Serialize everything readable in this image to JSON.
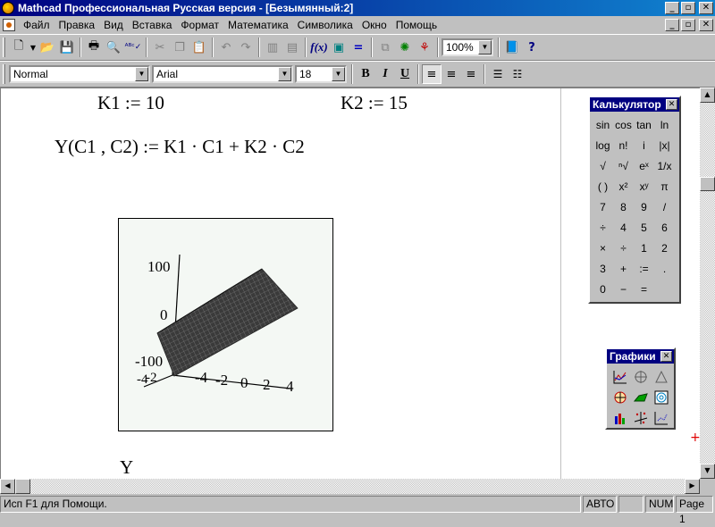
{
  "window": {
    "title": "Mathcad Профессиональная Русская версия - [Безымянный:2]",
    "buttons": [
      "_",
      "▫",
      "✕"
    ]
  },
  "menu": {
    "items": [
      "Файл",
      "Правка",
      "Вид",
      "Вставка",
      "Формат",
      "Математика",
      "Символика",
      "Окно",
      "Помощь"
    ],
    "doc_buttons": [
      "_",
      "▫",
      "✕"
    ]
  },
  "toolbar": {
    "zoom": "100%",
    "icons": [
      "new-icon",
      "open-icon",
      "save-icon",
      "print-icon",
      "print-preview-icon",
      "spellcheck-icon",
      "cut-icon",
      "copy-icon",
      "paste-icon",
      "undo-icon",
      "redo-icon",
      "align-icon",
      "insert-function-icon",
      "insert-unit-icon",
      "calculate-icon",
      "component-icon",
      "wizard-icon",
      "distributed-icon",
      "resource-center-icon",
      "help-icon"
    ]
  },
  "format_toolbar": {
    "style": "Normal",
    "font": "Arial",
    "size": "18",
    "bold": "B",
    "italic": "I",
    "underline": "U"
  },
  "worksheet": {
    "k1": "K1 := 10",
    "k2": "K2 := 15",
    "function_def": "Y(C1 , C2) := K1 · C1 + K2 · C2",
    "plot_label": "Y",
    "plot": {
      "z_ticks": [
        "100",
        "0",
        "-100"
      ],
      "x_ticks": [
        "-4",
        "-2",
        "0",
        "2",
        "4"
      ],
      "y_ticks": [
        "-4",
        "-2"
      ]
    }
  },
  "calculator": {
    "title": "Калькулятор",
    "buttons": [
      "sin",
      "cos",
      "tan",
      "ln",
      "log",
      "n!",
      "i",
      "|x|",
      "√",
      "ⁿ√",
      "eˣ",
      "1/x",
      "( )",
      "x²",
      "xʸ",
      "π",
      "7",
      "8",
      "9",
      "/",
      "÷",
      "4",
      "5",
      "6",
      "×",
      "÷",
      "1",
      "2",
      "3",
      "+",
      ":=",
      ".",
      "0",
      "−",
      "="
    ]
  },
  "graphs": {
    "title": "Графики",
    "icons": [
      "xy-plot-icon",
      "polar-plot-icon",
      "surface-plot-icon",
      "contour-plot-icon",
      "3d-scatter-icon",
      "3d-bar-icon",
      "vector-field-icon",
      "3d-scatter-alt-icon",
      "plot-wizard-icon"
    ]
  },
  "status": {
    "help": "Исп F1 для Помощи.",
    "mode": "АВТО",
    "empty": "",
    "num": "NUM",
    "page": "Page 1"
  }
}
